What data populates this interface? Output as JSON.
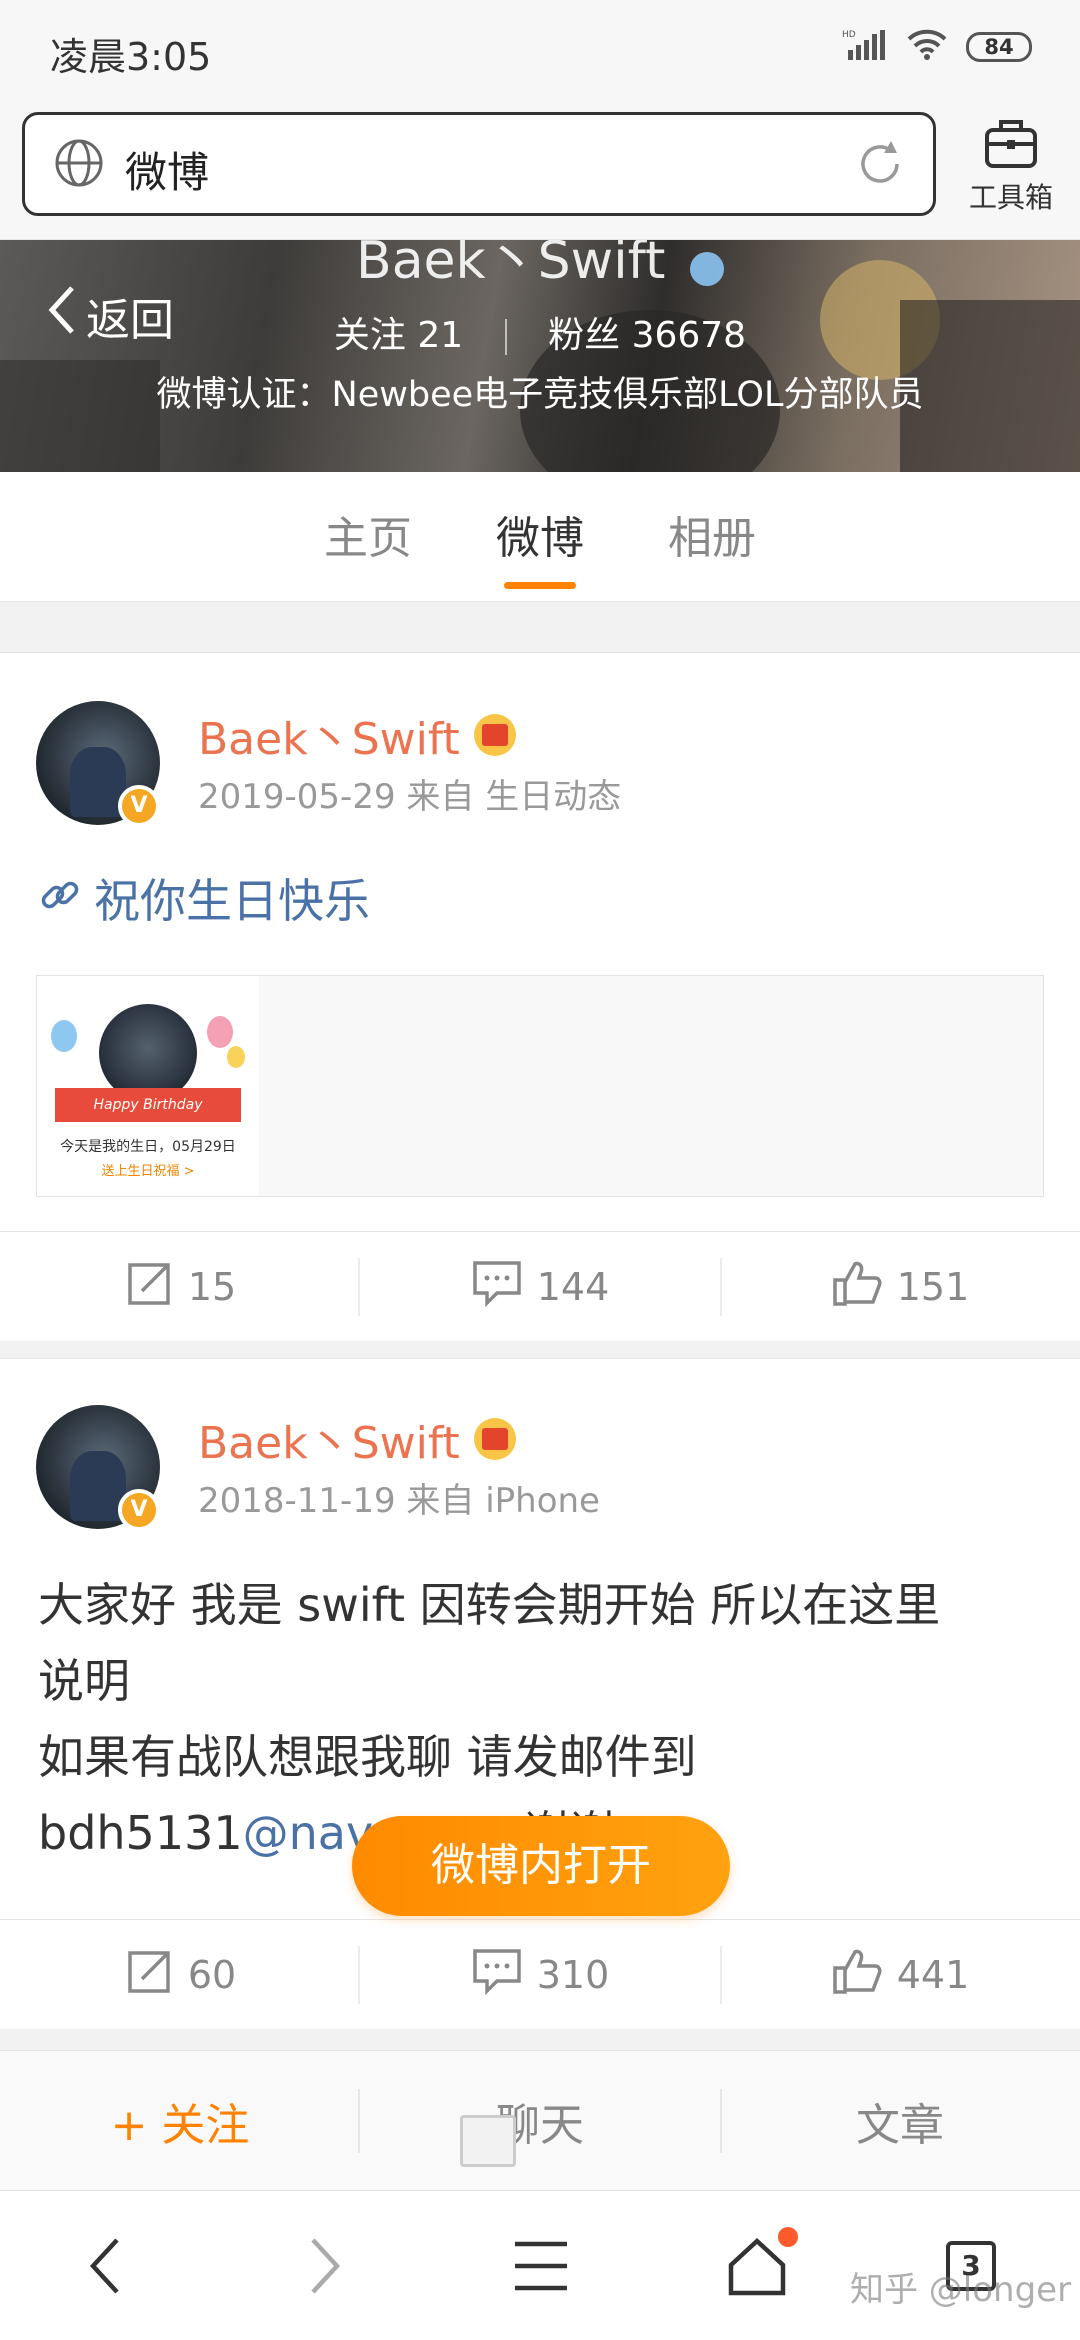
{
  "status_bar": {
    "time": "凌晨3:05",
    "network": "HD",
    "battery": "84"
  },
  "browser": {
    "url_text": "微博",
    "toolbox_label": "工具箱"
  },
  "profile": {
    "back_label": "返回",
    "name": "Baek丶Swift",
    "following_label": "关注",
    "following_count": "21",
    "followers_label": "粉丝",
    "followers_count": "36678",
    "verification": "微博认证：Newbee电子竞技俱乐部LOL分部队员"
  },
  "tabs": [
    {
      "label": "主页",
      "active": false
    },
    {
      "label": "微博",
      "active": true
    },
    {
      "label": "相册",
      "active": false
    }
  ],
  "posts": [
    {
      "author": "Baek丶Swift",
      "meta": "2019-05-29 来自 生日动态",
      "link_text": "祝你生日快乐",
      "card": {
        "banner": "Happy Birthday",
        "caption": "今天是我的生日，05月29日",
        "action": "送上生日祝福 >"
      },
      "reposts": "15",
      "comments": "144",
      "likes": "151"
    },
    {
      "author": "Baek丶Swift",
      "meta": "2018-11-19 来自 iPhone",
      "line1": "大家好 我是 swift 因转会期开始 所以在这里",
      "line2": "说明",
      "line3": "如果有战队想跟我聊 请发邮件到",
      "line4_prefix": "bdh5131",
      "line4_link": "@nav",
      "line4_suffix": "谢谢",
      "reposts": "60",
      "comments": "310",
      "likes": "441"
    }
  ],
  "open_in_weibo": "微博内打开",
  "bottom_bar": {
    "follow": "+ 关注",
    "chat": "聊天",
    "article": "文章"
  },
  "nav": {
    "tab_count": "3"
  },
  "watermark": "知乎 @longer",
  "colors": {
    "accent_orange": "#ff8200",
    "username_orange": "#eb7350",
    "link_blue": "#4a72a6"
  }
}
